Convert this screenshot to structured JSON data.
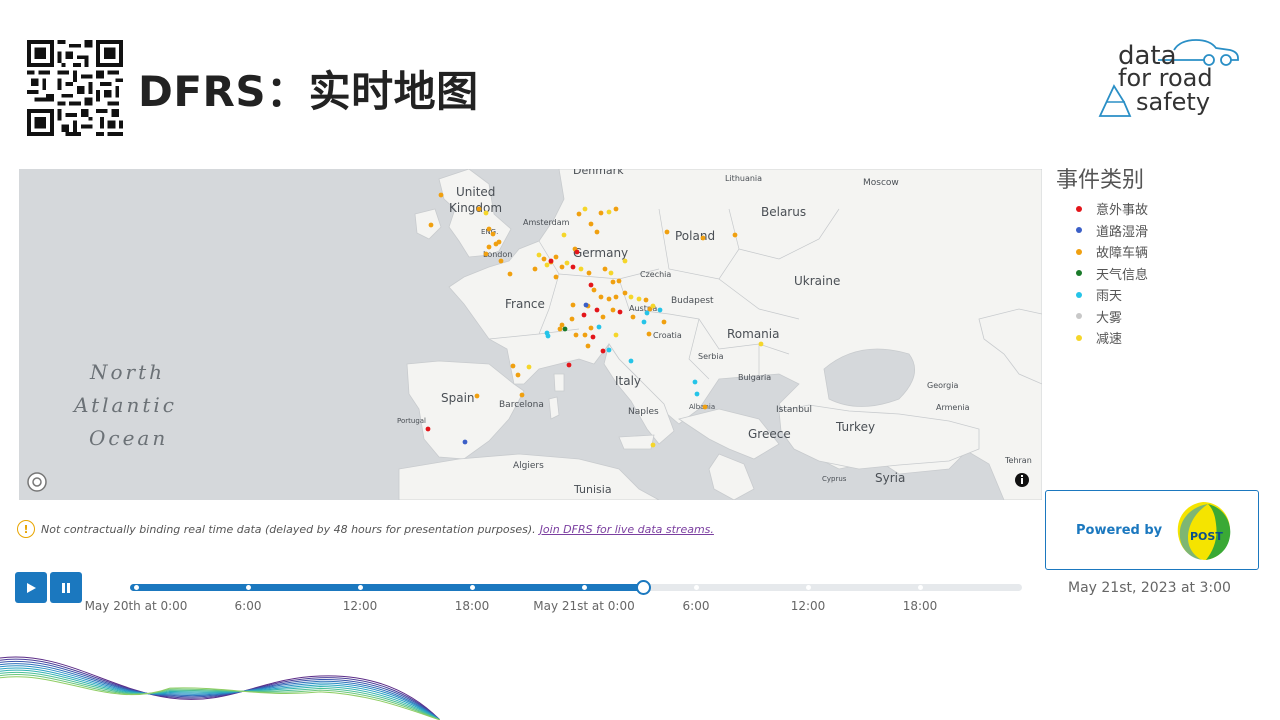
{
  "header": {
    "title": "DFRS：实时地图",
    "logo": {
      "line1": "data",
      "line2": "for road",
      "line3": "safety"
    }
  },
  "map": {
    "labels": [
      {
        "text": "United",
        "cls": "country"
      },
      {
        "text": "Kingdom",
        "cls": "country"
      },
      {
        "text": "Denmark",
        "cls": "small"
      },
      {
        "text": "Lithuania",
        "cls": "tiny"
      },
      {
        "text": "Moscow",
        "cls": "tiny"
      },
      {
        "text": "Belarus",
        "cls": "country"
      },
      {
        "text": "Amsterdam",
        "cls": "tiny"
      },
      {
        "text": "ENG.",
        "cls": "tiny"
      },
      {
        "text": "London",
        "cls": "tiny"
      },
      {
        "text": "Germany",
        "cls": "country"
      },
      {
        "text": "Poland",
        "cls": "country"
      },
      {
        "text": "Czechia",
        "cls": "tiny"
      },
      {
        "text": "Ukraine",
        "cls": "country"
      },
      {
        "text": "France",
        "cls": "country"
      },
      {
        "text": "Budapest",
        "cls": "tiny"
      },
      {
        "text": "Austria",
        "cls": "tiny"
      },
      {
        "text": "Croatia",
        "cls": "tiny"
      },
      {
        "text": "Romania",
        "cls": "country"
      },
      {
        "text": "Serbia",
        "cls": "tiny"
      },
      {
        "text": "Bulgaria",
        "cls": "tiny"
      },
      {
        "text": "Georgia",
        "cls": "tiny"
      },
      {
        "text": "Italy",
        "cls": "country"
      },
      {
        "text": "Spain",
        "cls": "country"
      },
      {
        "text": "Barcelona",
        "cls": "tiny"
      },
      {
        "text": "Portugal",
        "cls": "tiny"
      },
      {
        "text": "Naples",
        "cls": "tiny"
      },
      {
        "text": "Albania",
        "cls": "tiny"
      },
      {
        "text": "Istanbul",
        "cls": "tiny"
      },
      {
        "text": "Armenia",
        "cls": "tiny"
      },
      {
        "text": "Greece",
        "cls": "country"
      },
      {
        "text": "Turkey",
        "cls": "country"
      },
      {
        "text": "Algiers",
        "cls": "tiny"
      },
      {
        "text": "Tunisia",
        "cls": "small"
      },
      {
        "text": "Cyprus",
        "cls": "tiny"
      },
      {
        "text": "Syria",
        "cls": "country"
      },
      {
        "text": "Tehran",
        "cls": "tiny"
      },
      {
        "text": "North",
        "cls": "ocean"
      },
      {
        "text": "Atlantic",
        "cls": "ocean"
      },
      {
        "text": "Ocean",
        "cls": "ocean"
      }
    ]
  },
  "legend": {
    "title": "事件类别",
    "items": [
      {
        "label": "意外事故",
        "color": "#e3151a"
      },
      {
        "label": "道路湿滑",
        "color": "#3b5fc7"
      },
      {
        "label": "故障车辆",
        "color": "#f0a010"
      },
      {
        "label": "天气信息",
        "color": "#1a7a2a"
      },
      {
        "label": "雨天",
        "color": "#25c4e8"
      },
      {
        "label": "大雾",
        "color": "#c8c8c8"
      },
      {
        "label": "减速",
        "color": "#f5d62a"
      }
    ]
  },
  "notice": {
    "icon": "!",
    "text": "Not contractually binding real time data (delayed by 48 hours for presentation purposes).",
    "link": "Join DFRS for live data streams."
  },
  "powered": {
    "label": "Powered by",
    "brand": "POST"
  },
  "timeline": {
    "ticks": [
      "May 20th at 0:00",
      "6:00",
      "12:00",
      "18:00",
      "May 21st at 0:00",
      "6:00",
      "12:00",
      "18:00"
    ],
    "progress": 0.57,
    "current": "May 21st, 2023 at 3:00"
  },
  "colors": {
    "accent": "#1b78bf"
  }
}
